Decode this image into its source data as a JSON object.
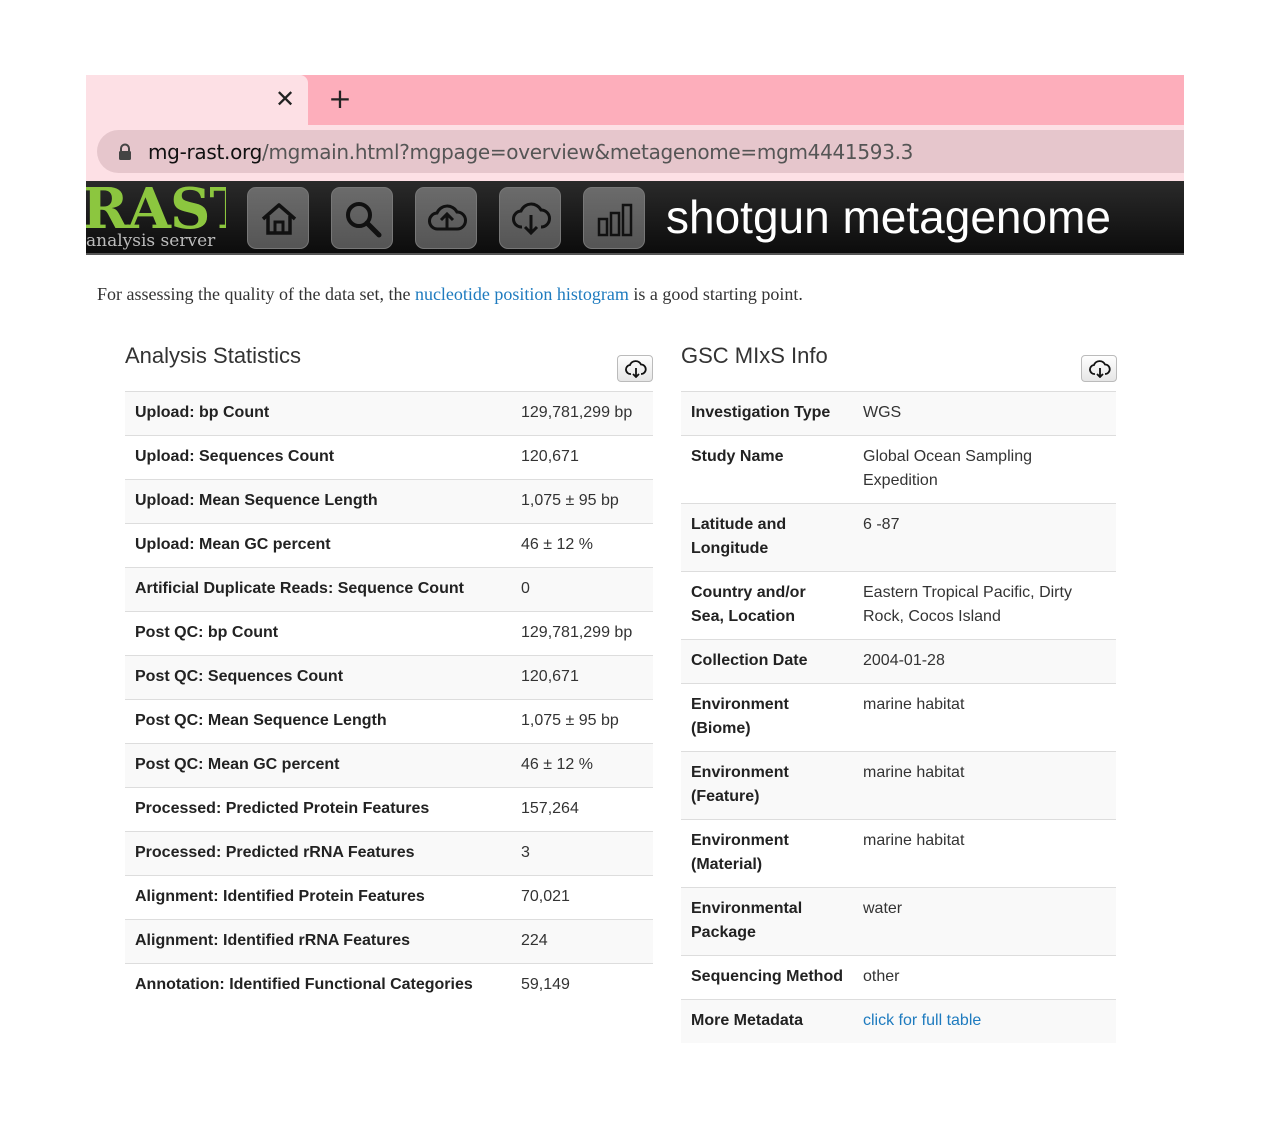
{
  "browser": {
    "tab_close_icon": "close-icon",
    "new_tab_icon": "plus-icon",
    "url_domain": "mg-rast.org",
    "url_path": "/mgmain.html?mgpage=overview&metagenome=mgm4441593.3"
  },
  "header": {
    "logo_big": "RAST",
    "logo_small": "analysis server",
    "nav": [
      "home-icon",
      "search-icon",
      "upload-icon",
      "download-icon",
      "analysis-icon"
    ],
    "title": "shotgun metagenome"
  },
  "intro": {
    "before": "For assessing the quality of the data set, the ",
    "link": "nucleotide position histogram",
    "after": " is a good starting point."
  },
  "stats": {
    "title": "Analysis Statistics",
    "rows": [
      {
        "label": "Upload: bp Count",
        "value": "129,781,299 bp"
      },
      {
        "label": "Upload: Sequences Count",
        "value": "120,671"
      },
      {
        "label": "Upload: Mean Sequence Length",
        "value": "1,075 ± 95 bp"
      },
      {
        "label": "Upload: Mean GC percent",
        "value": "46 ± 12 %"
      },
      {
        "label": "Artificial Duplicate Reads: Sequence Count",
        "value": "0"
      },
      {
        "label": "Post QC: bp Count",
        "value": "129,781,299 bp"
      },
      {
        "label": "Post QC: Sequences Count",
        "value": "120,671"
      },
      {
        "label": "Post QC: Mean Sequence Length",
        "value": "1,075 ± 95 bp"
      },
      {
        "label": "Post QC: Mean GC percent",
        "value": "46 ± 12 %"
      },
      {
        "label": "Processed: Predicted Protein Features",
        "value": "157,264"
      },
      {
        "label": "Processed: Predicted rRNA Features",
        "value": "3"
      },
      {
        "label": "Alignment: Identified Protein Features",
        "value": "70,021"
      },
      {
        "label": "Alignment: Identified rRNA Features",
        "value": "224"
      },
      {
        "label": "Annotation: Identified Functional Categories",
        "value": "59,149"
      }
    ]
  },
  "mixs": {
    "title": "GSC MIxS Info",
    "rows": [
      {
        "label": "Investigation Type",
        "value": "WGS"
      },
      {
        "label": "Study Name",
        "value": "Global Ocean Sampling Expedition"
      },
      {
        "label": "Latitude and Longitude",
        "value": "6 -87"
      },
      {
        "label": "Country and/or Sea, Location",
        "value": "Eastern Tropical Pacific, Dirty Rock, Cocos Island"
      },
      {
        "label": "Collection Date",
        "value": "2004-01-28"
      },
      {
        "label": "Environment (Biome)",
        "value": "marine habitat"
      },
      {
        "label": "Environment (Feature)",
        "value": "marine habitat"
      },
      {
        "label": "Environment (Material)",
        "value": "marine habitat"
      },
      {
        "label": "Environmental Package",
        "value": "water"
      },
      {
        "label": "Sequencing Method",
        "value": "other"
      },
      {
        "label": "More Metadata",
        "value": "click for full table",
        "is_link": true
      }
    ]
  }
}
